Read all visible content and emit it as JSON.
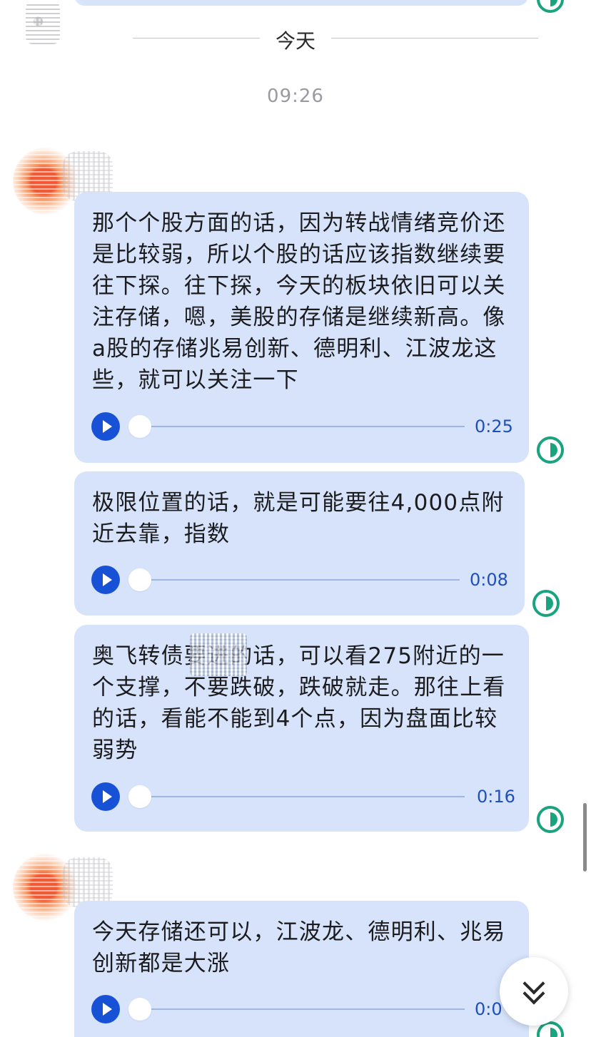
{
  "chat": {
    "day_label": "今天",
    "time_label": "09:26"
  },
  "messages": [
    {
      "text": "那个个股方面的话，因为转战情绪竞价还是比较弱，所以个股的话应该指数继续要往下探。往下探，今天的板块依旧可以关注存储，嗯，美股的存储是继续新高。像a股的存储兆易创新、德明利、江波龙这些，就可以关注一下",
      "duration": "0:25",
      "progress": 0
    },
    {
      "text": "极限位置的话，就是可能要往4,000点附近去靠，指数",
      "duration": "0:08",
      "progress": 0
    },
    {
      "text": "奥飞转债要进的话，可以看275附近的一个支撑，不要跌破，跌破就走。那往上看的话，看能不能到4个点，因为盘面比较弱势",
      "duration": "0:16",
      "progress": 0
    },
    {
      "text": "今天存储还可以，江波龙、德明利、兆易创新都是大涨",
      "duration": "0:0",
      "progress": 0
    }
  ],
  "icons": {
    "play": "play-icon",
    "read_status": "read-status-icon",
    "scroll_down": "double-chevron-down-icon"
  },
  "colors": {
    "bubble": "#d6e3fb",
    "accent_blue": "#1751d6",
    "read_green": "#1aa37f"
  }
}
